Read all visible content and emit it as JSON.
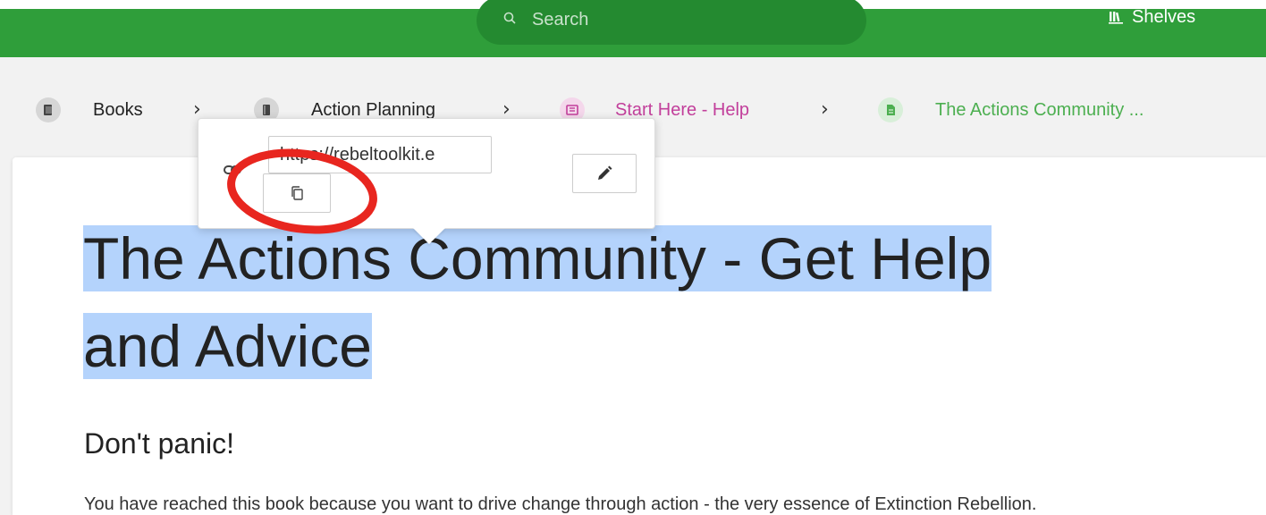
{
  "header": {
    "search_placeholder": "Search",
    "shelves_label": "Shelves"
  },
  "breadcrumb": [
    {
      "label": "Books",
      "color": "#222222",
      "icon_bg": "#d6d6d6",
      "icon_fg": "#444444",
      "icon": "books-icon"
    },
    {
      "label": "Action Planning",
      "color": "#222222",
      "icon_bg": "#d6d6d6",
      "icon_fg": "#444444",
      "icon": "book-icon"
    },
    {
      "label": "Start Here - Help",
      "color": "#c23f9b",
      "icon_bg": "#f4d7eb",
      "icon_fg": "#c23f9b",
      "icon": "chapter-icon"
    },
    {
      "label": "The Actions Community ...",
      "color": "#4caf50",
      "icon_bg": "#d8efd9",
      "icon_fg": "#4caf50",
      "icon": "page-icon"
    }
  ],
  "popover": {
    "url_value": "https://rebeltoolkit.e"
  },
  "page": {
    "title_line1": "The Actions Community - Get Help",
    "title_line2": "and Advice",
    "subtitle": "Don't panic!",
    "body": "You have reached this book because you want to drive change through action - the very essence of Extinction Rebellion."
  },
  "colors": {
    "header_green": "#2f9e3a",
    "selection": "#b4d3fc",
    "annotation_red": "#e8261f"
  }
}
